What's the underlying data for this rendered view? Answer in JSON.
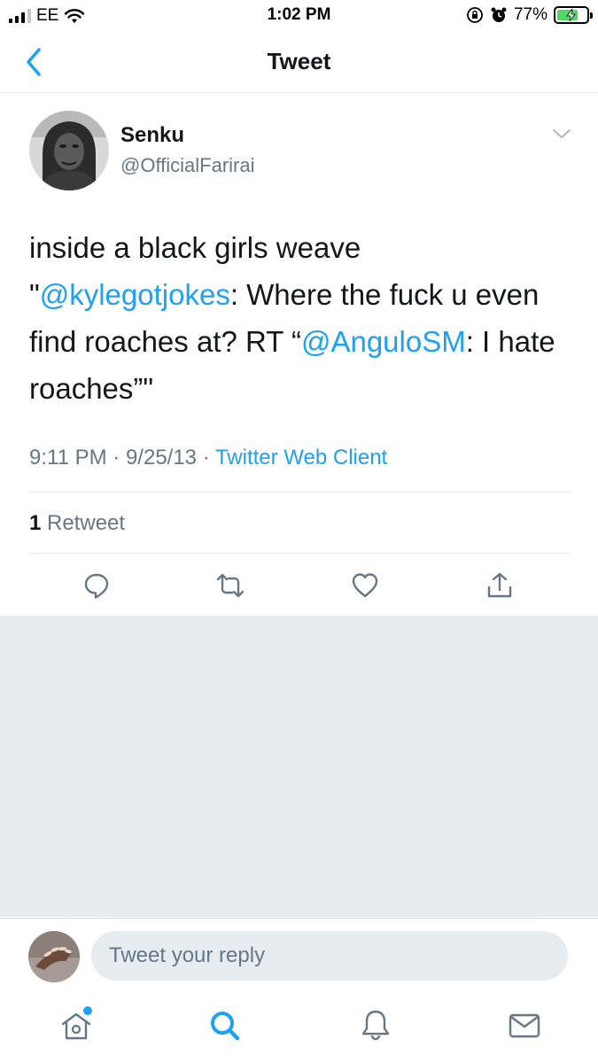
{
  "status_bar": {
    "carrier": "EE",
    "time": "1:02 PM",
    "battery_percent": "77%",
    "battery_level": 0.77,
    "icons": [
      "signal-icon",
      "wifi-icon",
      "orientation-lock-icon",
      "alarm-icon",
      "battery-charging-icon"
    ]
  },
  "nav": {
    "title": "Tweet",
    "back_icon": "chevron-left-icon"
  },
  "tweet": {
    "author_name": "Senku",
    "author_handle": "@OfficialFarirai",
    "text": {
      "part1": "inside a black girls weave",
      "part2": "\"",
      "mention1": "@kylegotjokes",
      "part3": ": Where the fuck u even find roaches at? RT “",
      "mention2": "@AnguloSM",
      "part4": ": I hate roaches”\""
    },
    "time": "9:11 PM",
    "date": "9/25/13",
    "separator": "·",
    "source": "Twitter Web Client",
    "retweet_count": "1",
    "retweet_label": "Retweet"
  },
  "actions": [
    "reply-icon",
    "retweet-icon",
    "like-icon",
    "share-icon"
  ],
  "reply_bar": {
    "placeholder": "Tweet your reply"
  },
  "tab_bar": [
    "home-icon",
    "search-icon",
    "notifications-icon",
    "messages-icon"
  ],
  "colors": {
    "accent": "#1da1f2",
    "text": "#14171a",
    "secondary_text": "#657786",
    "background_gray": "#e6ecf0",
    "divider": "#e1e8ed"
  }
}
